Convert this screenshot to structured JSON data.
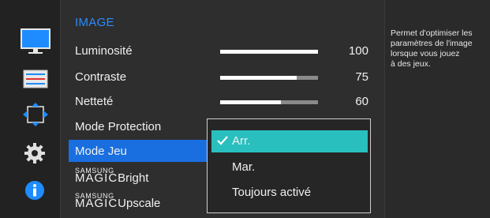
{
  "menu": {
    "title": "IMAGE",
    "rows": [
      {
        "label": "Luminosité",
        "value": "100",
        "level": 1.0
      },
      {
        "label": "Contraste",
        "value": "75",
        "level": 0.78
      },
      {
        "label": "Netteté",
        "value": "60",
        "level": 0.62
      },
      {
        "label": "Mode Protection"
      },
      {
        "label": "Mode Jeu",
        "selected": true
      },
      {
        "brand_top": "SAMSUNG",
        "brand_bottom": "MAGIC",
        "label": "Bright"
      },
      {
        "brand_top": "SAMSUNG",
        "brand_bottom": "MAGIC",
        "label": "Upscale"
      }
    ]
  },
  "dropdown": {
    "options": [
      {
        "label": "Arr.",
        "checked": true
      },
      {
        "label": "Mar.",
        "checked": false
      },
      {
        "label": "Toujours activé",
        "checked": false
      }
    ]
  },
  "info_text": "Permet d'optimiser les\nparamètres de l'image\nlorsque vous jouez\nà des jeux.",
  "sidebar": {
    "icons": [
      "monitor-icon",
      "sliders-icon",
      "resize-icon",
      "gear-icon",
      "info-icon"
    ]
  },
  "colors": {
    "accent_blue": "#1a6fe0",
    "title_blue": "#2a8cff",
    "check_teal": "#2abfbf"
  }
}
